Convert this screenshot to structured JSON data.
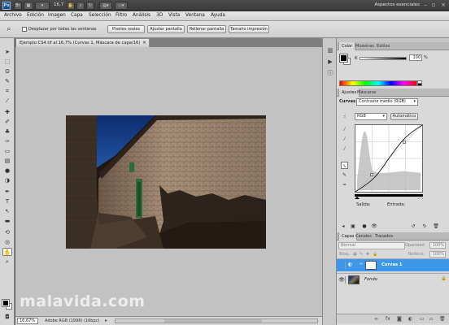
{
  "app": {
    "logo": "Ps",
    "zoom": "16,7",
    "workspace": "Aspectos esenciales"
  },
  "menu": [
    "Archivo",
    "Edición",
    "Imagen",
    "Capa",
    "Selección",
    "Filtro",
    "Análisis",
    "3D",
    "Vista",
    "Ventana",
    "Ayuda"
  ],
  "options": {
    "scroll_all_label": "Desplazar por todas las ventanas",
    "buttons": [
      "Píxeles reales",
      "Ajustar pantalla",
      "Rellenar pantalla",
      "Tamaño impresión"
    ]
  },
  "document": {
    "tab_title": "Ejemplo CS4.tif al 16,7% (Curvas 1, Máscara de capa/16)",
    "zoom_field": "16,67%",
    "profile": "Adobe RGB (1998) (16bpc)"
  },
  "color_panel": {
    "tabs": [
      "Color",
      "Muestras",
      "Estilos"
    ],
    "channel_label": "K",
    "value": "100",
    "unit": "%"
  },
  "adjustments_panel": {
    "tabs": [
      "Ajustes",
      "Máscaras"
    ],
    "title": "Curvas",
    "preset": "Contraste medio (RGB)",
    "channel": "RGB",
    "auto_label": "Automático",
    "output_label": "Salida:",
    "input_label": "Entrada:"
  },
  "layers_panel": {
    "tabs": [
      "Capas",
      "Canales",
      "Trazados"
    ],
    "blend_mode": "Normal",
    "opacity_label": "Opacidad:",
    "opacity_value": "100%",
    "lock_label": "Bloq.:",
    "fill_label": "Relleno:",
    "fill_value": "100%",
    "layers": [
      {
        "name": "Curvas 1",
        "selected": true
      },
      {
        "name": "Fondo",
        "selected": false
      }
    ]
  },
  "watermark": "malavida.com",
  "colors": {
    "selection_blue": "#3d97ea",
    "ps_blue": "#1b4f8a"
  }
}
